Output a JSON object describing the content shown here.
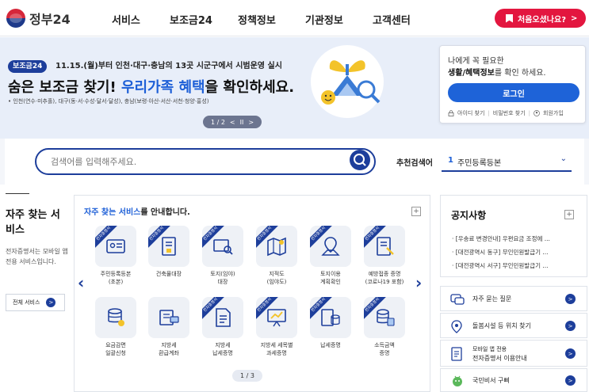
{
  "header": {
    "logo_text": "정부24",
    "nav": [
      "서비스",
      "보조금24",
      "정책정보",
      "기관정보",
      "고객센터"
    ],
    "welcome_button": "처음오셨나요?",
    "welcome_arrow": ">"
  },
  "hero": {
    "badge": "보조금24",
    "notice": "11.15.(월)부터 인천·대구·충남의 13곳 시군구에서 시범운영 실시",
    "title_a": "숨은 보조금 찾기! ",
    "title_b": "우리가족 혜택",
    "title_c": "을 확인하세요.",
    "sub": "• 인천(연수·미추홀), 대구(동·서·수성·달서·달성), 충남(보령·아산·서산·서천·청양·홍성)",
    "pager": "1 / 2",
    "pager_prev": "<",
    "pager_pause": "II",
    "pager_next": ">"
  },
  "login": {
    "line1": "나에게 꼭 필요한",
    "line2_bold": "생활/혜택정보",
    "line2_rest": "를 확인 하세요.",
    "button": "로그인",
    "links": [
      "아이디 찾기",
      "비밀번호 찾기",
      "회원가입"
    ],
    "separator": "|"
  },
  "search": {
    "placeholder": "검색어를 입력해주세요.",
    "rec_label": "추천검색어",
    "rec_num": "1",
    "rec_value": "주민등록등본",
    "rec_chevron": "⌄"
  },
  "left": {
    "title": "자주 찾는 서비스",
    "desc": "전자증명서는 모바일 앱 전용 서비스입니다.",
    "all_button": "전체 서비스",
    "all_arrow": ">"
  },
  "services": {
    "head_hl": "자주 찾는 서비스",
    "head_rest": "를 안내합니다.",
    "plus": "+",
    "arrow_prev": "‹",
    "arrow_next": "›",
    "ribbon": "전자증명서",
    "tiles": [
      {
        "label": "주민등록등본\n(초본)",
        "icon": "id-card-icon",
        "ribbon": true
      },
      {
        "label": "건축물대장",
        "icon": "building-document-icon",
        "ribbon": true
      },
      {
        "label": "토지(임야)\n대장",
        "icon": "land-register-icon",
        "ribbon": true
      },
      {
        "label": "지적도\n(임야도)",
        "icon": "map-icon",
        "ribbon": true
      },
      {
        "label": "토지이용\n계획확인",
        "icon": "land-use-icon",
        "ribbon": true
      },
      {
        "label": "예방접종 증명\n(코로나19 포함)",
        "icon": "vaccine-document-icon",
        "ribbon": true
      },
      {
        "label": "요금감면\n일괄신청",
        "icon": "coin-stack-icon",
        "ribbon": false
      },
      {
        "label": "지방세\n환급계좌",
        "icon": "refund-account-icon",
        "ribbon": false
      },
      {
        "label": "지방세\n납세증명",
        "icon": "tax-document-icon",
        "ribbon": true
      },
      {
        "label": "지방세 세목별\n과세증명",
        "icon": "tax-chart-icon",
        "ribbon": true
      },
      {
        "label": "납세증명",
        "icon": "tax-payment-icon",
        "ribbon": true
      },
      {
        "label": "소득금액\n증명",
        "icon": "income-icon",
        "ribbon": true
      }
    ],
    "pager": "1 / 3"
  },
  "notice": {
    "title": "공지사항",
    "plus": "+",
    "items": [
      "[우송료 변경안내] 우편요금 조정에 ...",
      "[대전광역시 동구] 무인민원발급기 ...",
      "[대전광역시 서구] 무인민원발급기 ..."
    ]
  },
  "quick_links": [
    {
      "label": "자주 묻는 질문",
      "icon": "faq-icon"
    },
    {
      "label": "돌봄시설 등 위치 찾기",
      "icon": "location-pin-icon"
    },
    {
      "label_1": "모바일 앱 전용",
      "label_2": "전자증명서 이용안내",
      "icon": "mobile-document-icon"
    },
    {
      "label": "국민비서 구삐",
      "icon": "assistant-icon"
    }
  ],
  "quick_arrow": ">",
  "colors": {
    "primary": "#1d3e9b",
    "accent_blue": "#1e63d8",
    "welcome_red": "#e3163f",
    "hero_bg": "#e8eef9"
  }
}
